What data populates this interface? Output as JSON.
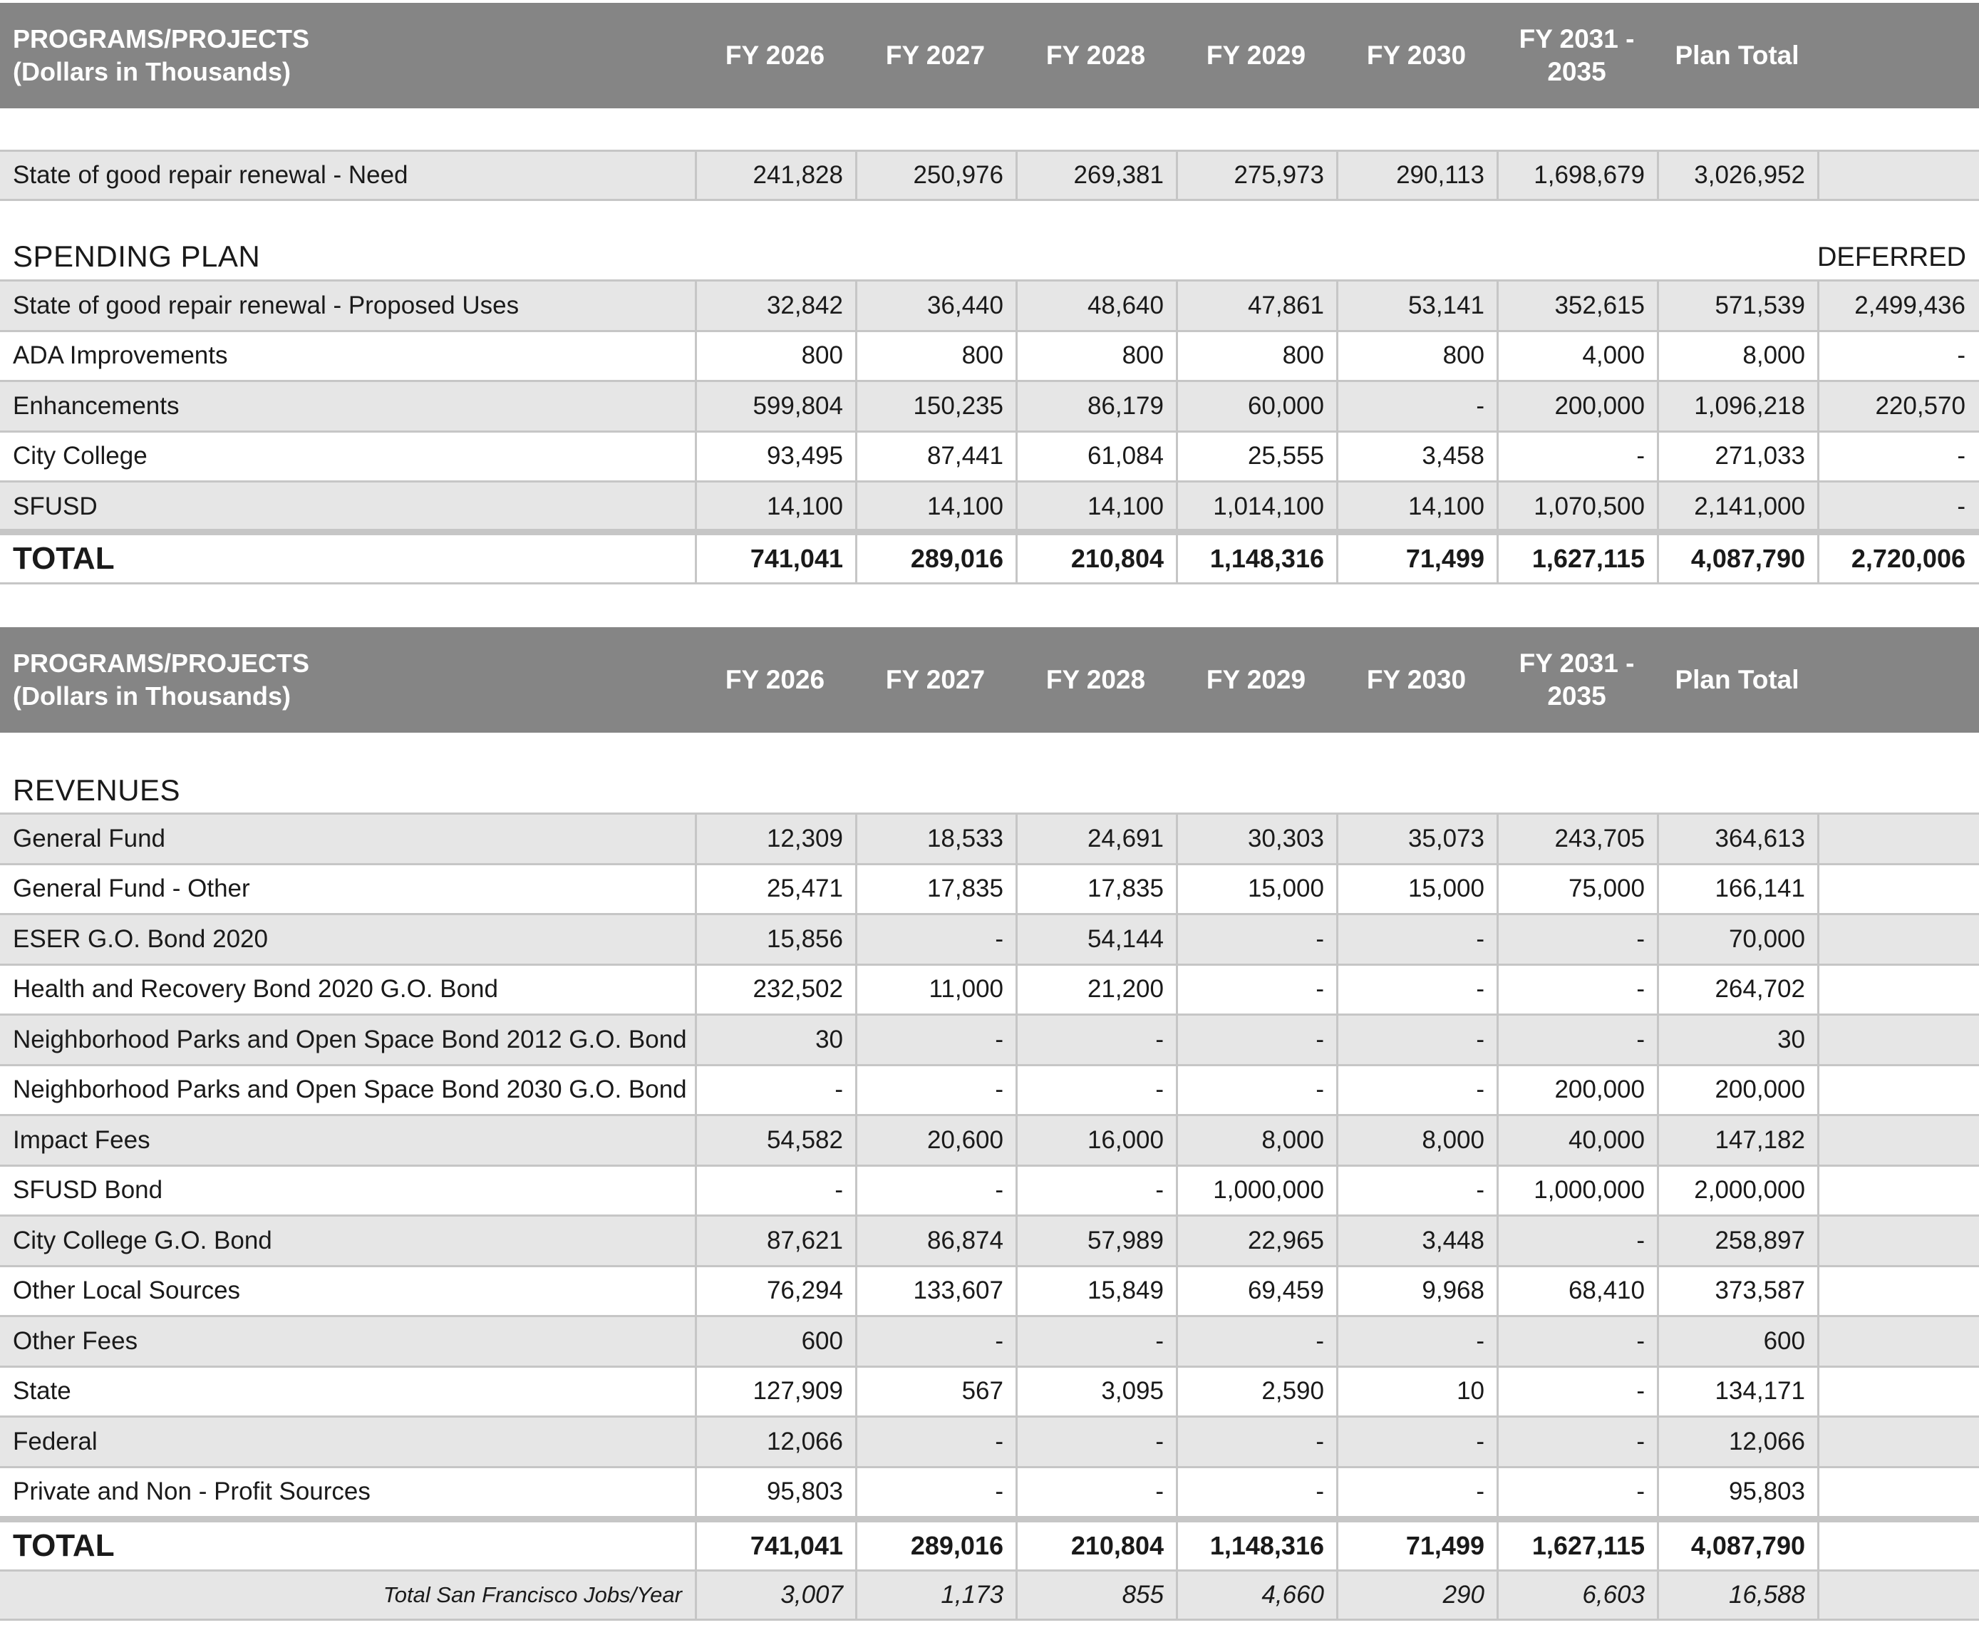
{
  "header": {
    "label_line1": "PROGRAMS/PROJECTS",
    "label_line2": "(Dollars in Thousands)",
    "columns": [
      "FY 2026",
      "FY 2027",
      "FY 2028",
      "FY 2029",
      "FY 2030",
      "FY 2031 -",
      "Plan Total"
    ],
    "fy2031_line2": "2035"
  },
  "need_row": {
    "label": "State of good repair renewal - Need",
    "values": [
      "241,828",
      "250,976",
      "269,381",
      "275,973",
      "290,113",
      "1,698,679",
      "3,026,952",
      ""
    ]
  },
  "spending": {
    "title": "SPENDING PLAN",
    "deferred_label": "DEFERRED",
    "rows": [
      {
        "label": "State of good repair renewal - Proposed Uses",
        "values": [
          "32,842",
          "36,440",
          "48,640",
          "47,861",
          "53,141",
          "352,615",
          "571,539",
          "2,499,436"
        ]
      },
      {
        "label": "ADA Improvements",
        "values": [
          "800",
          "800",
          "800",
          "800",
          "800",
          "4,000",
          "8,000",
          "-"
        ]
      },
      {
        "label": "Enhancements",
        "values": [
          "599,804",
          "150,235",
          "86,179",
          "60,000",
          "-",
          "200,000",
          "1,096,218",
          "220,570"
        ]
      },
      {
        "label": "City College",
        "values": [
          "93,495",
          "87,441",
          "61,084",
          "25,555",
          "3,458",
          "-",
          "271,033",
          "-"
        ]
      },
      {
        "label": "SFUSD",
        "values": [
          "14,100",
          "14,100",
          "14,100",
          "1,014,100",
          "14,100",
          "1,070,500",
          "2,141,000",
          "-"
        ]
      }
    ],
    "total": {
      "label": "TOTAL",
      "values": [
        "741,041",
        "289,016",
        "210,804",
        "1,148,316",
        "71,499",
        "1,627,115",
        "4,087,790",
        "2,720,006"
      ]
    }
  },
  "revenues": {
    "title": "REVENUES",
    "rows": [
      {
        "label": "General Fund",
        "values": [
          "12,309",
          "18,533",
          "24,691",
          "30,303",
          "35,073",
          "243,705",
          "364,613",
          ""
        ]
      },
      {
        "label": "General Fund - Other",
        "values": [
          "25,471",
          "17,835",
          "17,835",
          "15,000",
          "15,000",
          "75,000",
          "166,141",
          ""
        ]
      },
      {
        "label": "ESER G.O. Bond 2020",
        "values": [
          "15,856",
          "-",
          "54,144",
          "-",
          "-",
          "-",
          "70,000",
          ""
        ]
      },
      {
        "label": "Health and Recovery Bond 2020 G.O. Bond",
        "values": [
          "232,502",
          "11,000",
          "21,200",
          "-",
          "-",
          "-",
          "264,702",
          ""
        ]
      },
      {
        "label": "Neighborhood Parks and Open Space Bond 2012 G.O. Bond",
        "values": [
          "30",
          "-",
          "-",
          "-",
          "-",
          "-",
          "30",
          ""
        ]
      },
      {
        "label": "Neighborhood Parks and Open Space Bond 2030 G.O. Bond",
        "values": [
          "-",
          "-",
          "-",
          "-",
          "-",
          "200,000",
          "200,000",
          ""
        ]
      },
      {
        "label": "Impact Fees",
        "values": [
          "54,582",
          "20,600",
          "16,000",
          "8,000",
          "8,000",
          "40,000",
          "147,182",
          ""
        ]
      },
      {
        "label": "SFUSD Bond",
        "values": [
          "-",
          "-",
          "-",
          "1,000,000",
          "-",
          "1,000,000",
          "2,000,000",
          ""
        ]
      },
      {
        "label": "City College G.O. Bond",
        "values": [
          "87,621",
          "86,874",
          "57,989",
          "22,965",
          "3,448",
          "-",
          "258,897",
          ""
        ]
      },
      {
        "label": "Other Local Sources",
        "values": [
          "76,294",
          "133,607",
          "15,849",
          "69,459",
          "9,968",
          "68,410",
          "373,587",
          ""
        ]
      },
      {
        "label": "Other Fees",
        "values": [
          "600",
          "-",
          "-",
          "-",
          "-",
          "-",
          "600",
          ""
        ]
      },
      {
        "label": "State",
        "values": [
          "127,909",
          "567",
          "3,095",
          "2,590",
          "10",
          "-",
          "134,171",
          ""
        ]
      },
      {
        "label": "Federal",
        "values": [
          "12,066",
          "-",
          "-",
          "-",
          "-",
          "-",
          "12,066",
          ""
        ]
      },
      {
        "label": "Private and Non - Profit Sources",
        "values": [
          "95,803",
          "-",
          "-",
          "-",
          "-",
          "-",
          "95,803",
          ""
        ]
      }
    ],
    "total": {
      "label": "TOTAL",
      "values": [
        "741,041",
        "289,016",
        "210,804",
        "1,148,316",
        "71,499",
        "1,627,115",
        "4,087,790",
        ""
      ]
    },
    "jobs": {
      "label": "Total San Francisco Jobs/Year",
      "values": [
        "3,007",
        "1,173",
        "855",
        "4,660",
        "290",
        "6,603",
        "16,588",
        ""
      ]
    }
  }
}
